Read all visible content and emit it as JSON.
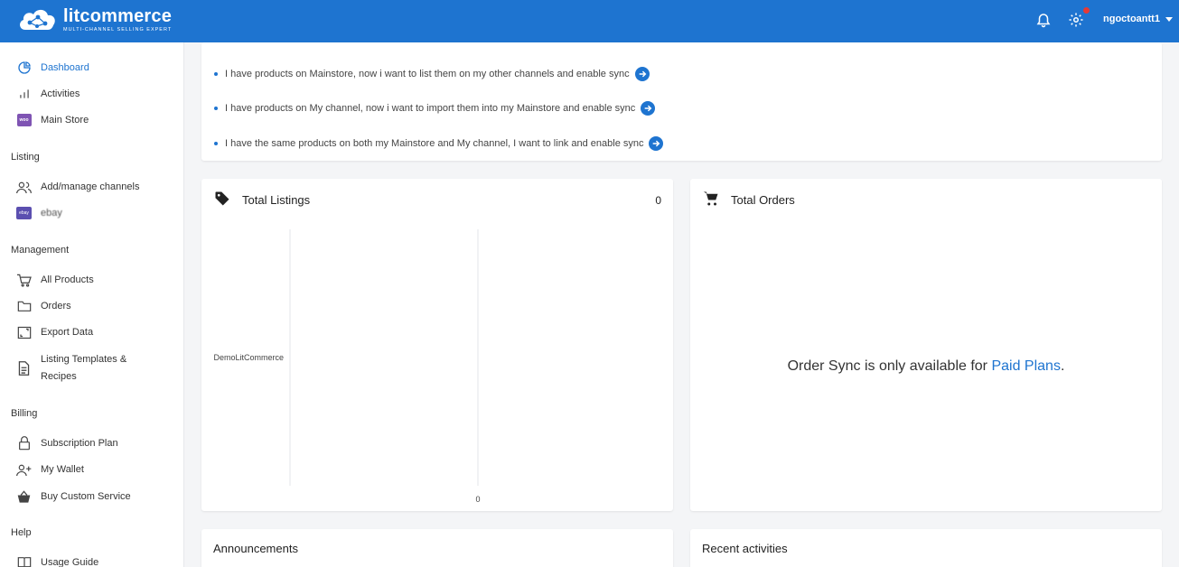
{
  "header": {
    "brand_name": "litcommerce",
    "brand_tagline": "MULTI-CHANNEL SELLING EXPERT",
    "user_name": "ngoctoantt1",
    "accent_color": "#1e74d0"
  },
  "sidebar": {
    "top_items": [
      {
        "label": "Dashboard",
        "icon": "pie-chart-icon",
        "active": true
      },
      {
        "label": "Activities",
        "icon": "bar-chart-icon"
      },
      {
        "label": "Main Store",
        "icon": "woo-icon"
      }
    ],
    "sections": {
      "listing": "Listing",
      "management": "Management",
      "billing": "Billing",
      "help": "Help"
    },
    "listing_items": [
      {
        "label": "Add/manage channels",
        "icon": "users-icon"
      },
      {
        "label": "ebay",
        "icon": "ebay-icon"
      }
    ],
    "management_items": [
      {
        "label": "All Products",
        "icon": "cart-icon"
      },
      {
        "label": "Orders",
        "icon": "folder-icon"
      },
      {
        "label": "Export Data",
        "icon": "export-icon"
      },
      {
        "label": "Listing Templates &",
        "label2": "Recipes",
        "icon": "document-icon"
      }
    ],
    "billing_items": [
      {
        "label": "Subscription Plan",
        "icon": "lock-icon"
      },
      {
        "label": "My Wallet",
        "icon": "add-user-icon"
      },
      {
        "label": "Buy Custom Service",
        "icon": "basket-icon"
      }
    ],
    "help_items": [
      {
        "label": "Usage Guide",
        "icon": "book-icon"
      }
    ]
  },
  "guide": {
    "items": [
      "I have products on Mainstore, now i want to list them on my other channels and enable sync",
      "I have products on My channel, now i want to import them into my Mainstore and enable sync",
      "I have the same products on both my Mainstore and My channel, I want to link and enable sync"
    ]
  },
  "listings": {
    "title": "Total Listings",
    "count": "0"
  },
  "chart_data": {
    "type": "bar",
    "categories": [
      "DemoLitCommerce"
    ],
    "values": [
      0
    ],
    "x_tick_labels": [
      "0"
    ],
    "grid": true
  },
  "orders": {
    "title": "Total Orders",
    "message_prefix": "Order Sync is only available for ",
    "message_link": "Paid Plans",
    "message_suffix": "."
  },
  "announcements": {
    "title": "Announcements"
  },
  "recent": {
    "title": "Recent activities"
  }
}
